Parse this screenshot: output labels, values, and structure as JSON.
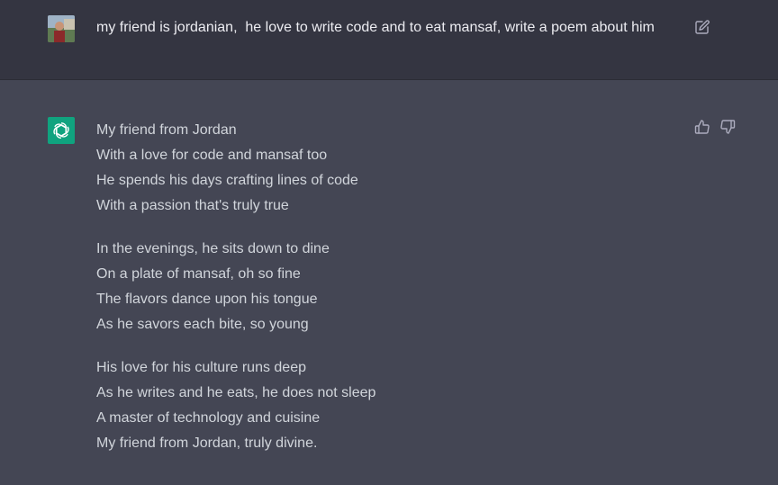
{
  "user_message": {
    "avatar": "user-avatar-photo",
    "text": "my friend is jordanian,  he love to write code and to eat mansaf, write a poem about him",
    "edit_icon": "edit-icon"
  },
  "assistant_message": {
    "avatar": "openai-logo-icon",
    "stanzas": [
      {
        "lines": [
          "My friend from Jordan",
          "With a love for code and mansaf too",
          "He spends his days crafting lines of code",
          "With a passion that's truly true"
        ]
      },
      {
        "lines": [
          "In the evenings, he sits down to dine",
          "On a plate of mansaf, oh so fine",
          "The flavors dance upon his tongue",
          "As he savors each bite, so young"
        ]
      },
      {
        "lines": [
          "His love for his culture runs deep",
          "As he writes and he eats, he does not sleep",
          "A master of technology and cuisine",
          "My friend from Jordan, truly divine."
        ]
      }
    ],
    "feedback_icons": [
      "thumbs-up-icon",
      "thumbs-down-icon"
    ]
  },
  "colors": {
    "user_bg": "#343541",
    "assistant_bg": "#444654",
    "text": "#d1d5db",
    "accent": "#10a37f"
  }
}
